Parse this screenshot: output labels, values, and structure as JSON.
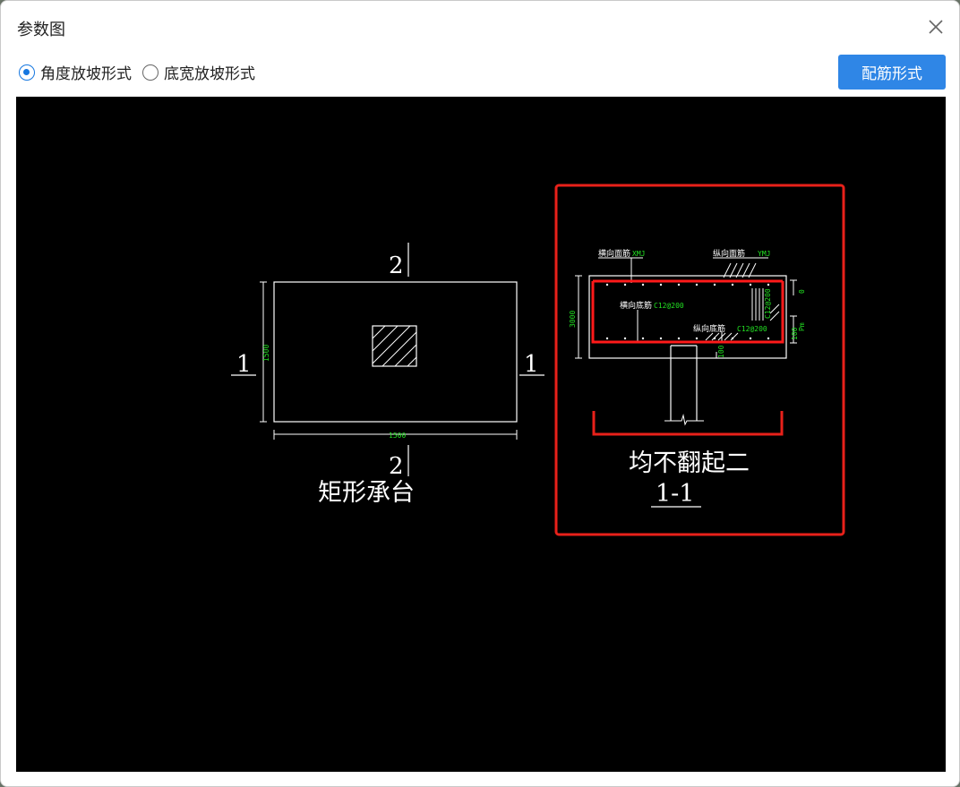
{
  "window": {
    "title": "参数图",
    "close_icon": "close-icon"
  },
  "options": {
    "slope_modes": [
      {
        "label": "角度放坡形式",
        "selected": true
      },
      {
        "label": "底宽放坡形式",
        "selected": false
      }
    ],
    "rebar_form_button": "配筋形式"
  },
  "drawing": {
    "plan": {
      "title": "矩形承台",
      "section_mark_top": "2",
      "section_mark_bottom": "2",
      "section_mark_left": "1",
      "section_mark_right": "1",
      "dim_height": "1500",
      "dim_width": "1500"
    },
    "section": {
      "label_top_transverse": "横向面筋",
      "label_top_transverse_code": "XMJ",
      "label_top_longitudinal": "纵向面筋",
      "label_top_longitudinal_code": "YMJ",
      "label_bottom_transverse": "横向底筋",
      "label_bottom_transverse_spec": "C12@200",
      "label_bottom_longitudinal": "纵向底筋",
      "label_bottom_longitudinal_spec": "C12@200",
      "dim_side": "C12@200",
      "dim_height": "3000",
      "dim_cover_top": "0",
      "dim_cover_bottom": "Pm",
      "dim_100": "100",
      "dim_pile": "100",
      "caption": "均不翻起二",
      "section_label": "1-1",
      "highlight_color": "#e8211a"
    }
  }
}
